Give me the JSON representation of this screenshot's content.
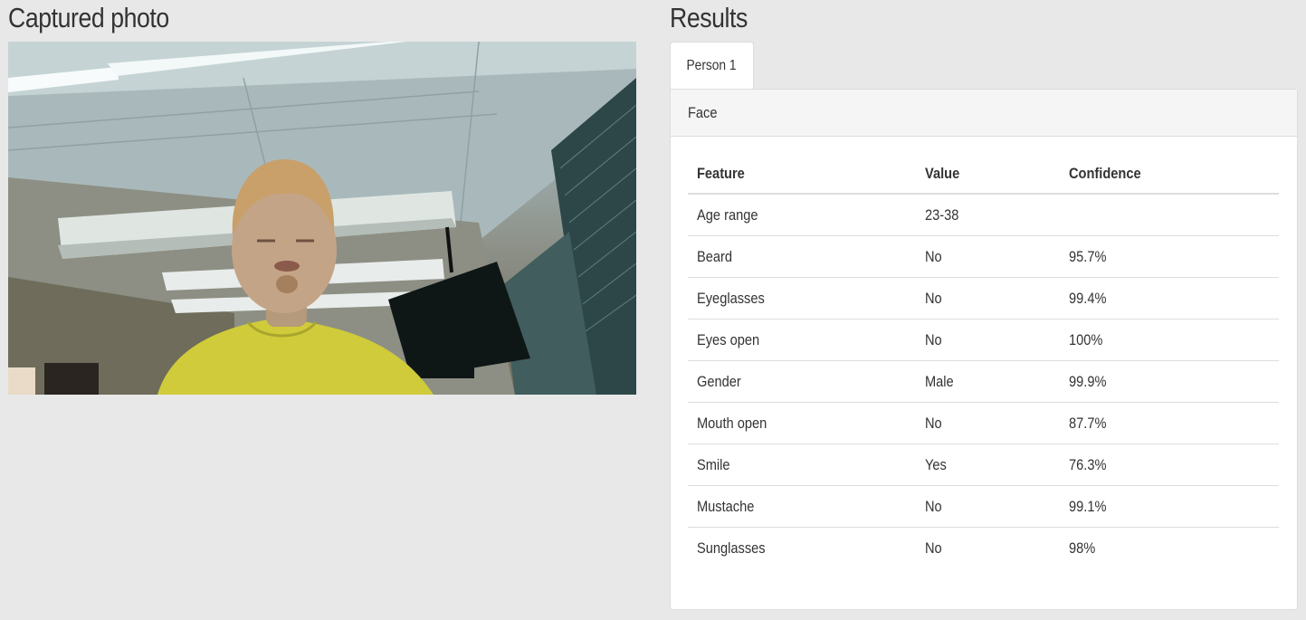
{
  "left": {
    "title": "Captured photo"
  },
  "right": {
    "title": "Results",
    "tabs": [
      {
        "label": "Person 1"
      }
    ],
    "panel": {
      "heading": "Face",
      "columns": [
        "Feature",
        "Value",
        "Confidence"
      ],
      "rows": [
        {
          "feature": "Age range",
          "value": "23-38",
          "confidence": ""
        },
        {
          "feature": "Beard",
          "value": "No",
          "confidence": "95.7%"
        },
        {
          "feature": "Eyeglasses",
          "value": "No",
          "confidence": "99.4%"
        },
        {
          "feature": "Eyes open",
          "value": "No",
          "confidence": "100%"
        },
        {
          "feature": "Gender",
          "value": "Male",
          "confidence": "99.9%"
        },
        {
          "feature": "Mouth open",
          "value": "No",
          "confidence": "87.7%"
        },
        {
          "feature": "Smile",
          "value": "Yes",
          "confidence": "76.3%"
        },
        {
          "feature": "Mustache",
          "value": "No",
          "confidence": "99.1%"
        },
        {
          "feature": "Sunglasses",
          "value": "No",
          "confidence": "98%"
        }
      ]
    }
  }
}
